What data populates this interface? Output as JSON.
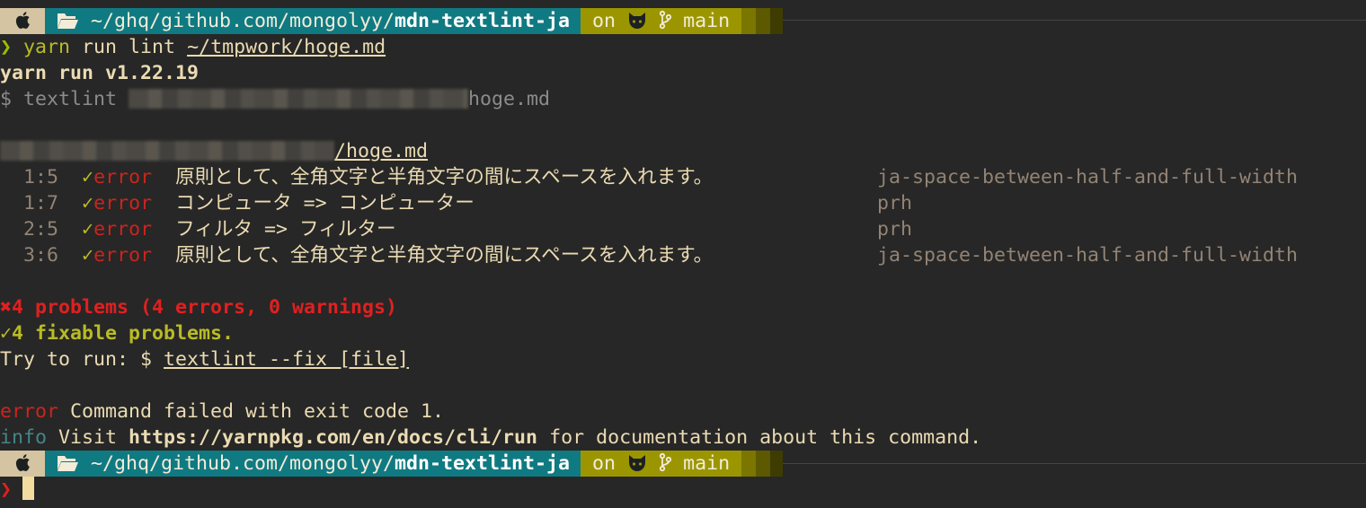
{
  "prompt": {
    "os_icon": "apple-icon",
    "folder_icon": "folder-open-icon",
    "path_prefix": "~/ghq/github.com/mongolyy/",
    "path_repo": "mdn-textlint-ja",
    "on_label": "on",
    "git_icon": "github-cat-icon",
    "branch_icon": "git-branch-icon",
    "branch": "main",
    "symbol": "❯"
  },
  "command": {
    "runner": "yarn",
    "args": " run lint ",
    "file": "~/tmpwork/hoge.md"
  },
  "output": {
    "yarn_version": "yarn run v1.22.19",
    "textlint_cmd": "$ textlint ",
    "textlint_file": "hoge.md",
    "report_file": "/hoge.md",
    "messages": [
      {
        "loc": "1:5",
        "check": "✓",
        "level": "error",
        "text": "原則として、全角文字と半角文字の間にスペースを入れます。",
        "rule": "ja-space-between-half-and-full-width"
      },
      {
        "loc": "1:7",
        "check": "✓",
        "level": "error",
        "text": "コンピュータ => コンピューター",
        "rule": "prh"
      },
      {
        "loc": "2:5",
        "check": "✓",
        "level": "error",
        "text": "フィルタ => フィルター",
        "rule": "prh"
      },
      {
        "loc": "3:6",
        "check": "✓",
        "level": "error",
        "text": "原則として、全角文字と半角文字の間にスペースを入れます。",
        "rule": "ja-space-between-half-and-full-width"
      }
    ],
    "problems": "✖4 problems (4 errors, 0 warnings)",
    "fixable": "✓4 fixable problems.",
    "try_prefix": "Try to run: $ ",
    "try_cmd": "textlint --fix [file]",
    "error_label": "error",
    "error_msg": " Command failed with exit code 1.",
    "info_label": "info",
    "info_pre": " Visit ",
    "info_url": "https://yarnpkg.com/en/docs/cli/run",
    "info_post": " for documentation about this command."
  },
  "colors": {
    "background": "#272727",
    "prompt_dir": "#107a82",
    "prompt_git": "#9b9600",
    "error": "#cc241d",
    "success": "#b8bb26"
  }
}
